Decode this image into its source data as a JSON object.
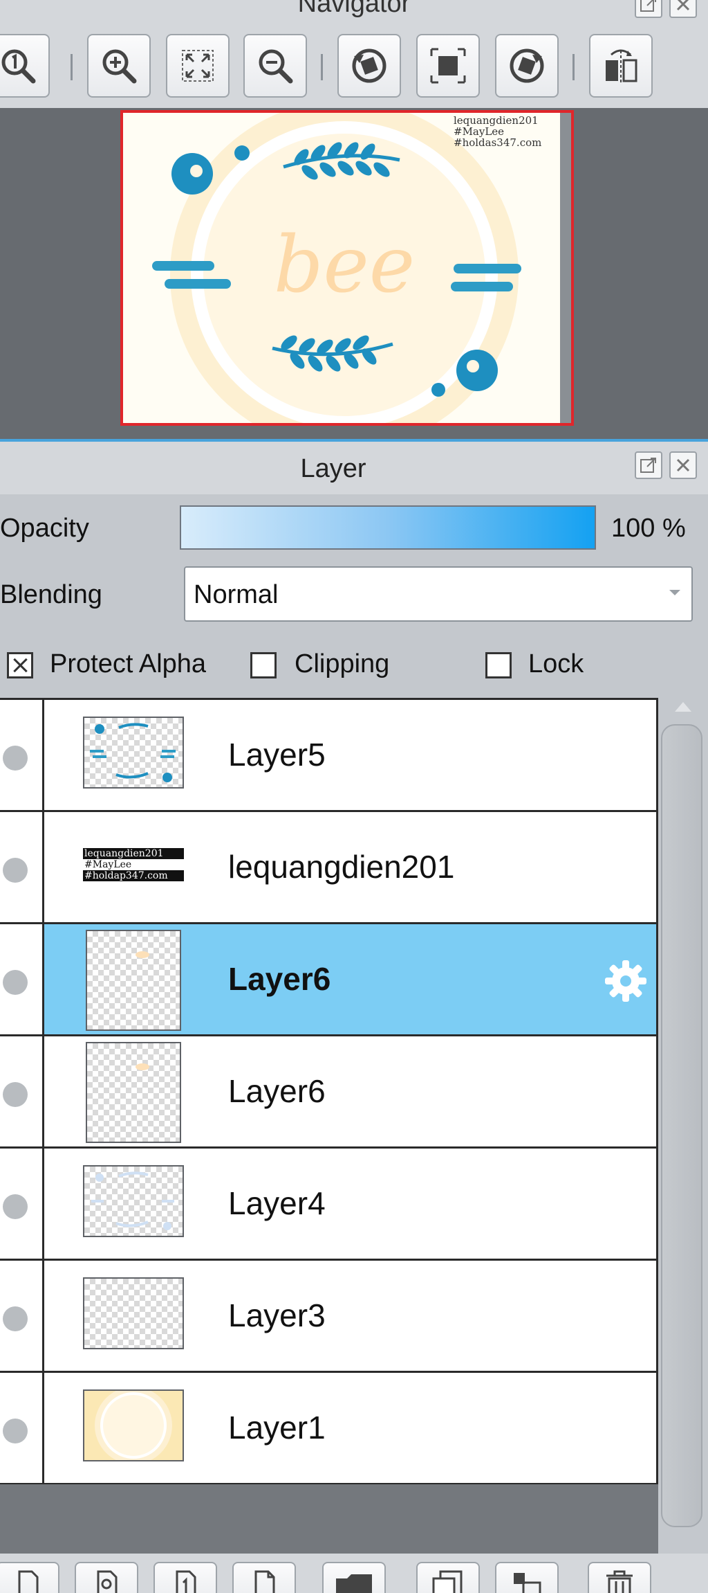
{
  "navigator": {
    "title": "Navigator",
    "toolbar": [
      {
        "name": "zoom-actual-size",
        "icon": "zoom-actual-icon"
      },
      {
        "name": "zoom-in",
        "icon": "zoom-in-icon"
      },
      {
        "name": "fit-to-window",
        "icon": "fit-window-icon"
      },
      {
        "name": "zoom-out",
        "icon": "zoom-out-icon"
      },
      {
        "name": "rotate-counterclockwise",
        "icon": "rotate-ccw-icon"
      },
      {
        "name": "reset-view",
        "icon": "reset-view-icon"
      },
      {
        "name": "rotate-clockwise",
        "icon": "rotate-cw-icon"
      },
      {
        "name": "flip-horizontal",
        "icon": "flip-horizontal-icon"
      }
    ],
    "preview": {
      "center_text": "bee",
      "watermark_lines": [
        "lequangdien201",
        "#MayLee",
        "#holdas347.com"
      ],
      "colors": {
        "frame": "#e0262b",
        "accent_blue": "#1e8fc0",
        "peach": "#fdd9a8",
        "cream_ring": "#fcefcf"
      }
    }
  },
  "layer_panel": {
    "title": "Layer",
    "opacity": {
      "label": "Opacity",
      "value_text": "100 %",
      "value": 100
    },
    "blending": {
      "label": "Blending",
      "value": "Normal"
    },
    "checkboxes": {
      "protect_alpha": {
        "label": "Protect Alpha",
        "checked": true
      },
      "clipping": {
        "label": "Clipping",
        "checked": false
      },
      "lock": {
        "label": "Lock",
        "checked": false
      }
    },
    "layers": [
      {
        "name": "Layer5",
        "selected": false,
        "thumb": "blue-decor"
      },
      {
        "name": "lequangdien201",
        "selected": false,
        "thumb": "text"
      },
      {
        "name": "Layer6",
        "selected": true,
        "thumb": "checker-portrait"
      },
      {
        "name": "Layer6",
        "selected": false,
        "thumb": "checker-portrait"
      },
      {
        "name": "Layer4",
        "selected": false,
        "thumb": "faint-decor"
      },
      {
        "name": "Layer3",
        "selected": false,
        "thumb": "checker"
      },
      {
        "name": "Layer1",
        "selected": false,
        "thumb": "cream-ring"
      }
    ],
    "thumb_text_lines": [
      "lequangdien201",
      "#MayLee",
      "#holdap347.com"
    ],
    "selected_color": "#7ccdf4"
  },
  "bottom_toolbar": [
    {
      "name": "new-layer",
      "icon": "new-layer-icon"
    },
    {
      "name": "new-layer-from-clipboard",
      "icon": "new-layer-clipboard-icon"
    },
    {
      "name": "new-1bit-layer",
      "icon": "new-1bit-layer-icon"
    },
    {
      "name": "new-halftone-layer",
      "icon": "new-halftone-layer-icon"
    },
    {
      "name": "new-folder",
      "icon": "folder-icon"
    },
    {
      "name": "duplicate-layer",
      "icon": "duplicate-icon"
    },
    {
      "name": "merge-down",
      "icon": "merge-down-icon"
    },
    {
      "name": "delete-layer",
      "icon": "trash-icon"
    }
  ]
}
